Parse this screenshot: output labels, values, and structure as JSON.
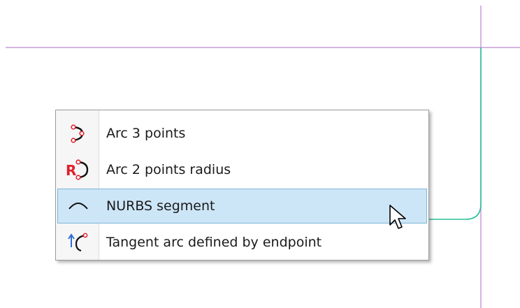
{
  "menu": {
    "items": [
      {
        "label": "Arc 3 points",
        "icon": "arc-3-points-icon"
      },
      {
        "label": "Arc 2 points radius",
        "icon": "arc-2-points-radius-icon"
      },
      {
        "label": "NURBS segment",
        "icon": "nurbs-segment-icon",
        "highlighted": true
      },
      {
        "label": "Tangent arc defined by endpoint",
        "icon": "tangent-arc-icon"
      }
    ]
  },
  "colors": {
    "guide_line": "#c89bd6",
    "sketch_curve": "#2bbf9b",
    "highlight_bg": "#cde6f7",
    "highlight_border": "#7eb4d9",
    "icon_red": "#e0202a",
    "icon_blue": "#2b6fd6"
  }
}
